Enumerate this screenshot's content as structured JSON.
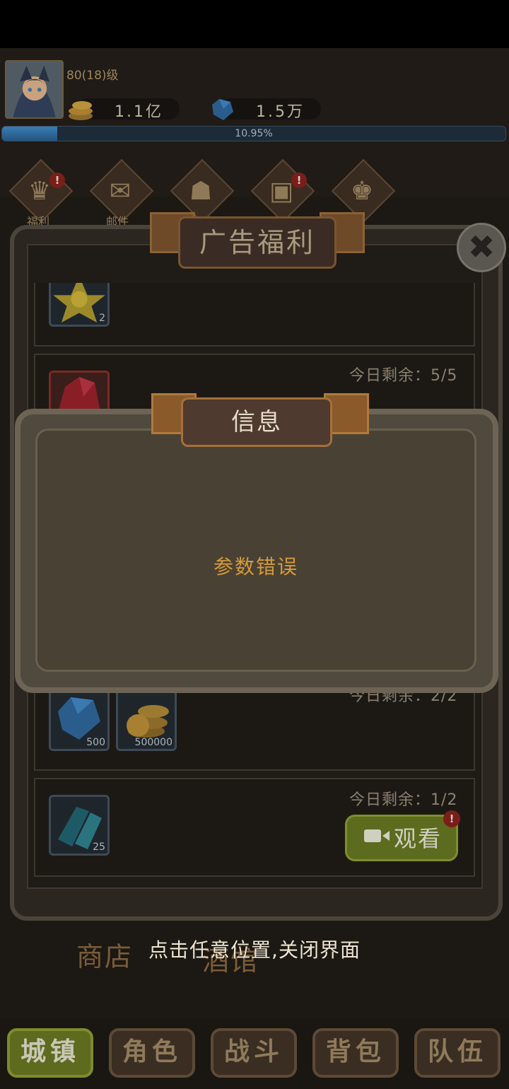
{
  "player": {
    "level": "80(18)级",
    "coins": "1.1亿",
    "gems": "1.5万",
    "xp_percent": "10.95%",
    "xp_fraction": 0.1095
  },
  "menu": [
    {
      "label": "福利",
      "icon": "welfare-icon",
      "badge": "!"
    },
    {
      "label": "邮件",
      "icon": "mail-icon"
    },
    {
      "label": "",
      "icon": "bag-icon"
    },
    {
      "label": "",
      "icon": "chest-icon",
      "badge": "!"
    },
    {
      "label": "",
      "icon": "rank-icon"
    }
  ],
  "ad_panel": {
    "title": "广告福利",
    "rows": [
      {
        "items": [
          {
            "icon": "star-item-icon",
            "qty": "2"
          }
        ],
        "remain": ""
      },
      {
        "items": [
          {
            "icon": "ruby-item-icon",
            "qty": ""
          }
        ],
        "remain": "今日剩余：5/5"
      },
      {
        "items": [
          {
            "icon": "diamond-item-icon",
            "qty": "500"
          },
          {
            "icon": "coin-item-icon",
            "qty": "500000"
          }
        ],
        "remain": "今日剩余：2/2"
      },
      {
        "items": [
          {
            "icon": "crystal-item-icon",
            "qty": "25"
          }
        ],
        "remain": "今日剩余：1/2",
        "button": "观看",
        "badge": "!"
      }
    ]
  },
  "dialog": {
    "title": "信息",
    "message": "参数错误"
  },
  "town": {
    "shop": "商店",
    "tavern": "酒馆"
  },
  "hint": "点击任意位置,关闭界面",
  "nav": [
    {
      "label": "城镇",
      "active": true
    },
    {
      "label": "角色"
    },
    {
      "label": "战斗"
    },
    {
      "label": "背包"
    },
    {
      "label": "队伍"
    }
  ],
  "colors": {
    "accent_text": "#d49b3a",
    "active_nav": "#5e6a1e",
    "badge": "#7a1e1a"
  }
}
